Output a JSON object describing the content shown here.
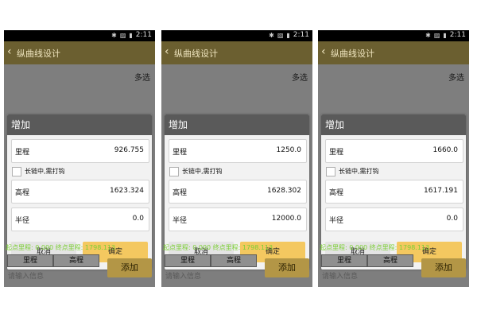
{
  "status": {
    "time": "2:11"
  },
  "header": {
    "title": "纵曲线设计"
  },
  "top_right": "多选",
  "dialog": {
    "title": "增加",
    "label_mileage": "里程",
    "checkbox_label": "长链中,需打钩",
    "label_elevation": "高程",
    "label_radius": "半径",
    "cancel": "取消",
    "confirm": "确定"
  },
  "bottom": {
    "info": "起点里程: 0.000  终点里程: 1798.113",
    "col_mileage": "里程",
    "col_elevation": "高程",
    "input_hint": "请输入信息",
    "add": "添加"
  },
  "screens": [
    {
      "mileage": "926.755",
      "elevation": "1623.324",
      "radius": "0.0"
    },
    {
      "mileage": "1250.0",
      "elevation": "1628.302",
      "radius": "12000.0"
    },
    {
      "mileage": "1660.0",
      "elevation": "1617.191",
      "radius": "0.0"
    }
  ],
  "colors": {
    "titlebar": "#6b5f30",
    "confirm": "#f4c860",
    "info_text": "#7ccf35"
  }
}
